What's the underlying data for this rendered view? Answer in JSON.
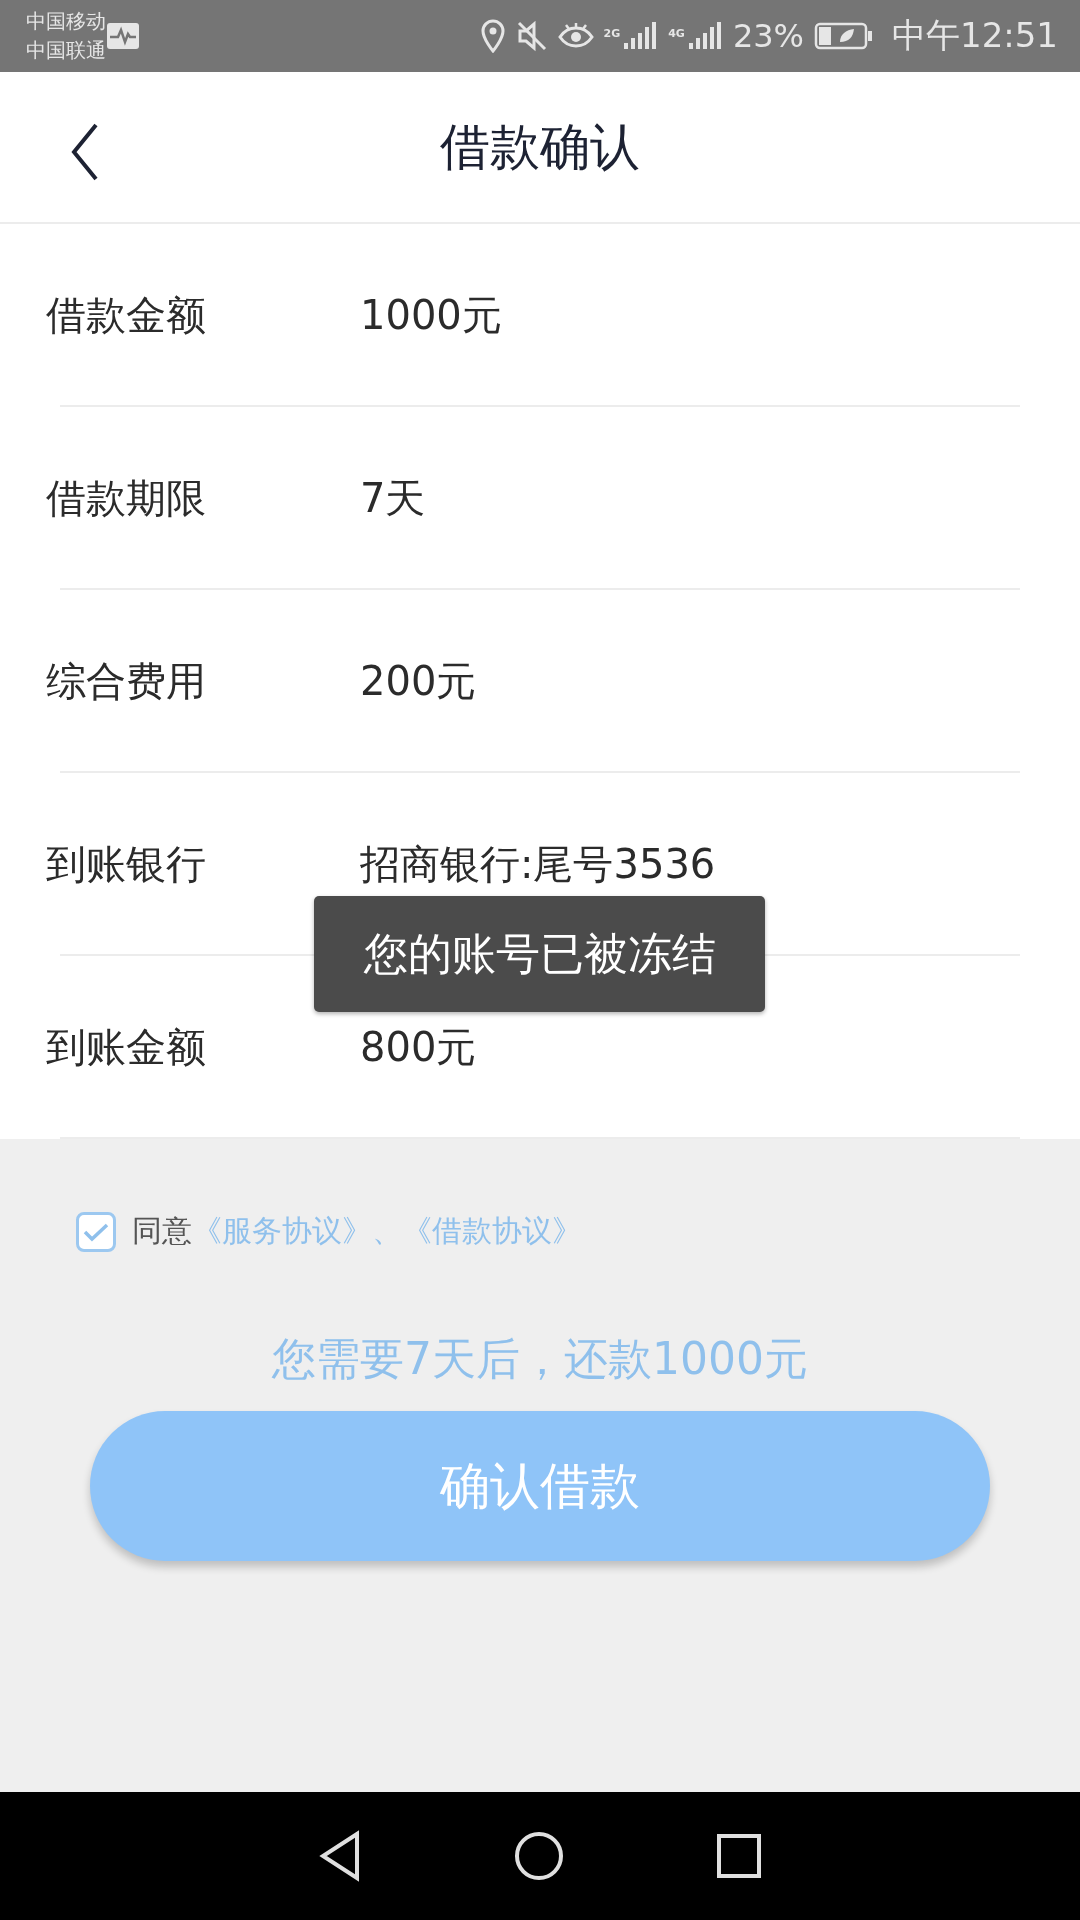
{
  "status_bar": {
    "carriers": [
      "中国移动",
      "中国联通"
    ],
    "network_labels": [
      "2G",
      "4G"
    ],
    "battery_percent": "23%",
    "time": "中午12:51"
  },
  "header": {
    "title": "借款确认"
  },
  "details": [
    {
      "label": "借款金额",
      "value": "1000元"
    },
    {
      "label": "借款期限",
      "value": "7天"
    },
    {
      "label": "综合费用",
      "value": "200元"
    },
    {
      "label": "到账银行",
      "value": "招商银行:尾号3536"
    },
    {
      "label": "到账金额",
      "value": "800元"
    }
  ],
  "toast": "您的账号已被冻结",
  "agreement": {
    "checked": true,
    "prefix": "同意",
    "links": [
      "《服务协议》",
      "《借款协议》"
    ],
    "separator": "、"
  },
  "repay_note": "您需要7天后，还款1000元",
  "confirm_button": "确认借款"
}
